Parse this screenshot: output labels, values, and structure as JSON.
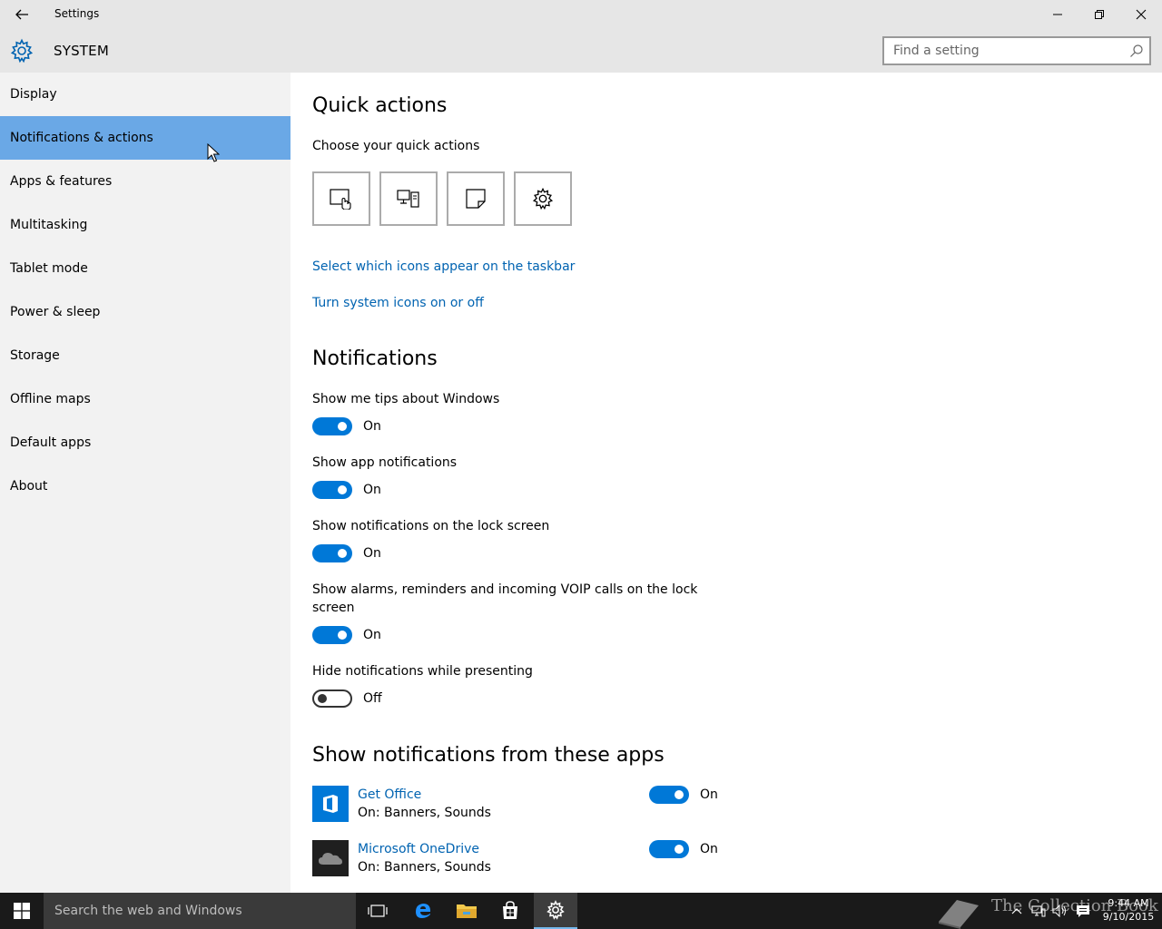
{
  "window": {
    "title": "Settings",
    "section": "SYSTEM"
  },
  "search": {
    "placeholder": "Find a setting"
  },
  "sidebar": {
    "items": [
      {
        "label": "Display"
      },
      {
        "label": "Notifications & actions",
        "active": true
      },
      {
        "label": "Apps & features"
      },
      {
        "label": "Multitasking"
      },
      {
        "label": "Tablet mode"
      },
      {
        "label": "Power & sleep"
      },
      {
        "label": "Storage"
      },
      {
        "label": "Offline maps"
      },
      {
        "label": "Default apps"
      },
      {
        "label": "About"
      }
    ]
  },
  "quick_actions": {
    "heading": "Quick actions",
    "subheading": "Choose your quick actions",
    "tiles": [
      "tablet-mode-icon",
      "project-icon",
      "note-icon",
      "all-settings-icon"
    ],
    "link_taskbar": "Select which icons appear on the taskbar",
    "link_system_icons": "Turn system icons on or off"
  },
  "notifications": {
    "heading": "Notifications",
    "settings": [
      {
        "label": "Show me tips about Windows",
        "state": "On",
        "on": true
      },
      {
        "label": "Show app notifications",
        "state": "On",
        "on": true
      },
      {
        "label": "Show notifications on the lock screen",
        "state": "On",
        "on": true
      },
      {
        "label_line1": "Show alarms, reminders and incoming VOIP calls on the lock",
        "label_line2": "screen",
        "state": "On",
        "on": true
      },
      {
        "label": "Hide notifications while presenting",
        "state": "Off",
        "on": false
      }
    ]
  },
  "apps": {
    "heading": "Show notifications from these apps",
    "items": [
      {
        "name": "Get Office",
        "detail": "On: Banners, Sounds",
        "state": "On",
        "on": true,
        "icon": "office-icon",
        "color": "#0078d7"
      },
      {
        "name": "Microsoft OneDrive",
        "detail": "On: Banners, Sounds",
        "state": "On",
        "on": true,
        "icon": "onedrive-icon",
        "color": "#1f1f1f"
      }
    ]
  },
  "taskbar": {
    "search_text": "Search the web and Windows",
    "time": "9:44 AM",
    "date": "9/10/2015",
    "watermark": "The Collection Book"
  },
  "colors": {
    "accent": "#0078d7",
    "active_nav": "#6aa8e6",
    "link": "#0063b1",
    "taskbar": "#1a1a1a"
  }
}
